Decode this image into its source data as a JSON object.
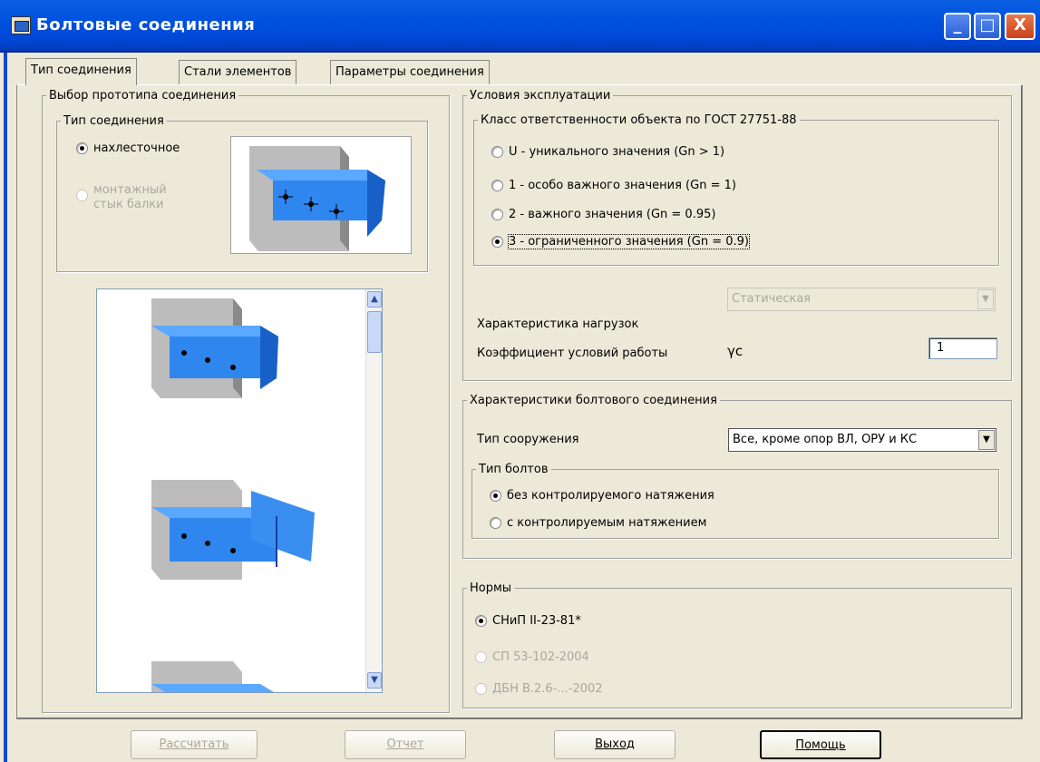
{
  "window": {
    "title": "Болтовые соединения",
    "min": "_",
    "max": "□",
    "close": "X"
  },
  "tabs": [
    "Тип соединения",
    "Стали элементов",
    "Параметры соединения"
  ],
  "prototype": {
    "legend": "Выбор прототипа соединения",
    "type_legend": "Тип соединения",
    "options": [
      "нахлесточное",
      "монтажный",
      "стык балки"
    ]
  },
  "conditions": {
    "legend": "Условия эксплуатации",
    "class_legend": "Класс ответственности объекта по ГОСТ 27751-88",
    "classes": [
      "U - уникального значения (Gn > 1)",
      "1 - особо важного значения (Gn = 1)",
      "2 - важного значения (Gn = 0.95)",
      "3 - ограниченного значения (Gn = 0.9)"
    ],
    "load_label": "Характеристика нагрузок",
    "load_value": "Статическая",
    "coef_label": "Коэффициент условий работы",
    "coef_symbol": "γc",
    "coef_value": "1"
  },
  "bolt": {
    "legend": "Характеристики болтового соединения",
    "structure_label": "Тип сооружения",
    "structure_value": "Все, кроме опор ВЛ, ОРУ и КС",
    "bolt_legend": "Тип болтов",
    "bolt_options": [
      "без контролируемого натяжения",
      "с контролируемым натяжением"
    ]
  },
  "norms": {
    "legend": "Нормы",
    "options": [
      "СНиП II-23-81*",
      "СП 53-102-2004",
      "ДБН В.2.6-...-2002"
    ]
  },
  "buttons": {
    "calc": "Рассчитать",
    "report": "Отчет",
    "exit": "Выход",
    "help": "Помощь"
  },
  "colors": {
    "title_bar": "#0053e0",
    "dialog_bg": "#ece9d8",
    "beam_blue": "#3a8ef0"
  }
}
